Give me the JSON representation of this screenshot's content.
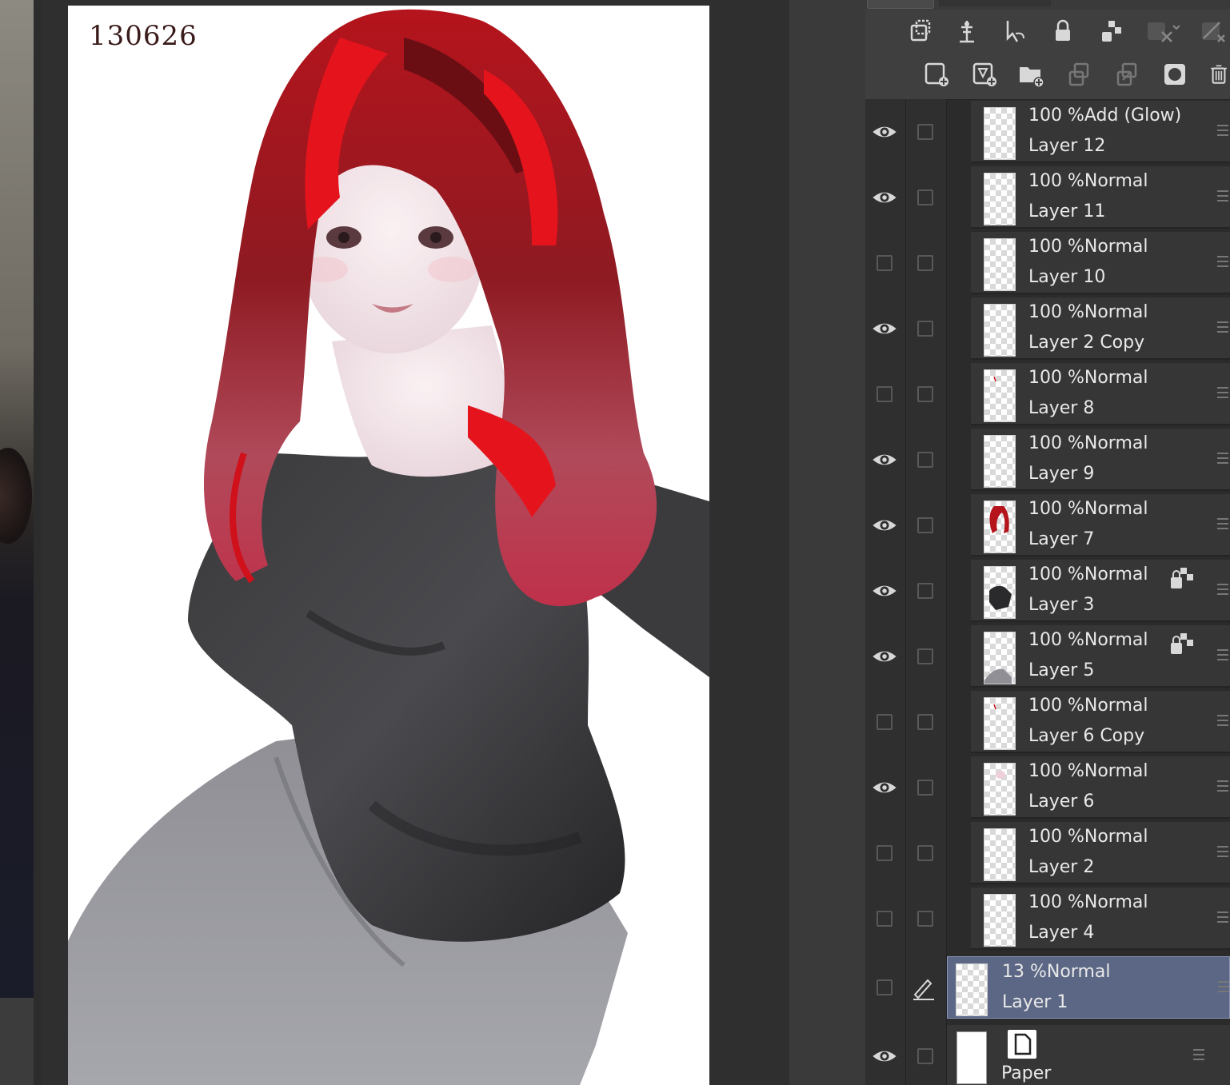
{
  "canvas": {
    "title": "130626"
  },
  "toolbar": {
    "row1_icons": [
      "clip-to-layer-below-icon",
      "reference-layer-icon",
      "set-selection-layer-icon",
      "lock-layer-icon",
      "lock-transparent-pixels-icon",
      "mask-disable-icon",
      "mask-apply-icon"
    ],
    "row2_icons": [
      "new-raster-layer-icon",
      "new-vector-layer-icon",
      "new-folder-icon",
      "transfer-to-layer-below-icon",
      "combine-with-layer-below-icon",
      "create-mask-icon",
      "delete-layer-icon"
    ]
  },
  "layers": [
    {
      "mode": "100 %Add (Glow)",
      "name": "Layer 12",
      "visible": true,
      "locked_alpha": false,
      "thumb": "empty"
    },
    {
      "mode": "100 %Normal",
      "name": "Layer 11",
      "visible": true,
      "locked_alpha": false,
      "thumb": "empty"
    },
    {
      "mode": "100 %Normal",
      "name": "Layer 10",
      "visible": false,
      "locked_alpha": false,
      "thumb": "empty"
    },
    {
      "mode": "100 %Normal",
      "name": "Layer 2 Copy",
      "visible": true,
      "locked_alpha": false,
      "thumb": "empty"
    },
    {
      "mode": "100 %Normal",
      "name": "Layer 8",
      "visible": false,
      "locked_alpha": false,
      "thumb": "speck"
    },
    {
      "mode": "100 %Normal",
      "name": "Layer 9",
      "visible": true,
      "locked_alpha": false,
      "thumb": "empty"
    },
    {
      "mode": "100 %Normal",
      "name": "Layer 7",
      "visible": true,
      "locked_alpha": false,
      "thumb": "hair"
    },
    {
      "mode": "100 %Normal",
      "name": "Layer 3",
      "visible": true,
      "locked_alpha": true,
      "thumb": "shirt"
    },
    {
      "mode": "100 %Normal",
      "name": "Layer 5",
      "visible": true,
      "locked_alpha": true,
      "thumb": "pants"
    },
    {
      "mode": "100 %Normal",
      "name": "Layer 6 Copy",
      "visible": false,
      "locked_alpha": false,
      "thumb": "speck"
    },
    {
      "mode": "100 %Normal",
      "name": "Layer 6",
      "visible": true,
      "locked_alpha": false,
      "thumb": "face"
    },
    {
      "mode": "100 %Normal",
      "name": "Layer 2",
      "visible": false,
      "locked_alpha": false,
      "thumb": "empty"
    },
    {
      "mode": "100 %Normal",
      "name": "Layer 4",
      "visible": false,
      "locked_alpha": false,
      "thumb": "empty"
    }
  ],
  "active_layer": {
    "mode": "13 %Normal",
    "name": "Layer 1",
    "visible": false
  },
  "paper_layer": {
    "name": "Paper",
    "visible": true
  },
  "colors": {
    "panel_bg": "#2b2b2b",
    "selected_row": "#5b6784",
    "hair_red": "#c4121a",
    "shirt_black": "#2e2e30",
    "pants_gray": "#9a9aa0"
  }
}
